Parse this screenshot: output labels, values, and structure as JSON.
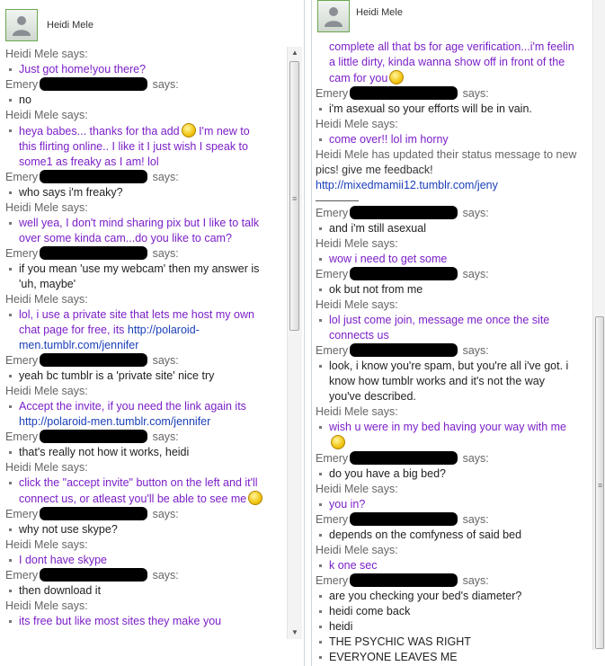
{
  "left": {
    "contact_name": "Heidi Mele",
    "messages": [
      {
        "speaker": "Heidi Mele",
        "says": "says:",
        "redacted": false,
        "lines": [
          {
            "text": "Just got home!you there?",
            "color": "purple"
          }
        ]
      },
      {
        "speaker": "Emery",
        "says": "says:",
        "redacted": true,
        "lines": [
          {
            "text": "no",
            "color": "black"
          }
        ]
      },
      {
        "speaker": "Heidi Mele",
        "says": "says:",
        "redacted": false,
        "lines": [
          {
            "text": "heya babes... thanks for tha add",
            "color": "purple",
            "smiley": true,
            "after": " I'm new to"
          },
          {
            "text": "this flirting online.. I like it I just wish I speak to",
            "color": "purple",
            "cont": true
          },
          {
            "text": "some1 as freaky as I am! lol",
            "color": "purple",
            "cont": true
          }
        ]
      },
      {
        "speaker": "Emery",
        "says": "says:",
        "redacted": true,
        "lines": [
          {
            "text": "who says i'm freaky?",
            "color": "black"
          }
        ]
      },
      {
        "speaker": "Heidi Mele",
        "says": "says:",
        "redacted": false,
        "lines": [
          {
            "text": "well yea, I  don't mind sharing pix but I like to talk",
            "color": "purple"
          },
          {
            "text": "over some kinda cam...do you like to cam?",
            "color": "purple",
            "cont": true
          }
        ]
      },
      {
        "speaker": "Emery",
        "says": "says:",
        "redacted": true,
        "lines": [
          {
            "text": "if you mean 'use my webcam' then my answer is",
            "color": "black"
          },
          {
            "text": "'uh, maybe'",
            "color": "black",
            "cont": true
          }
        ]
      },
      {
        "speaker": "Heidi Mele",
        "says": "says:",
        "redacted": false,
        "lines": [
          {
            "text": "lol, i use a private site that lets me host my own",
            "color": "purple"
          },
          {
            "text": "chat page for free, its ",
            "color": "purple",
            "cont": true,
            "link": "http://polaroid-"
          },
          {
            "text": "",
            "color": "purple",
            "cont": true,
            "link": "men.tumblr.com/jennifer"
          }
        ]
      },
      {
        "speaker": "Emery",
        "says": "says:",
        "redacted": true,
        "lines": [
          {
            "text": "yeah bc tumblr is a 'private site' nice try",
            "color": "black"
          }
        ]
      },
      {
        "speaker": "Heidi Mele",
        "says": "says:",
        "redacted": false,
        "lines": [
          {
            "text": "Accept the invite, if you need the link again its",
            "color": "purple"
          },
          {
            "text": "",
            "color": "purple",
            "cont": true,
            "link": "http://polaroid-men.tumblr.com/jennifer"
          }
        ]
      },
      {
        "speaker": "Emery",
        "says": "says:",
        "redacted": true,
        "lines": [
          {
            "text": "that's really not how it works, heidi",
            "color": "black"
          }
        ]
      },
      {
        "speaker": "Heidi Mele",
        "says": "says:",
        "redacted": false,
        "lines": [
          {
            "text": "click the \"accept invite\" button on the left and it'll",
            "color": "purple"
          },
          {
            "text": "connect us, or atleast you'll be able to see me",
            "color": "purple",
            "cont": true,
            "smiley": true
          }
        ]
      },
      {
        "speaker": "Emery",
        "says": "says:",
        "redacted": true,
        "lines": [
          {
            "text": "why not use skype?",
            "color": "black"
          }
        ]
      },
      {
        "speaker": "Heidi Mele",
        "says": "says:",
        "redacted": false,
        "lines": [
          {
            "text": "I dont have skype",
            "color": "purple"
          }
        ]
      },
      {
        "speaker": "Emery",
        "says": "says:",
        "redacted": true,
        "lines": [
          {
            "text": "then download it",
            "color": "black"
          }
        ]
      },
      {
        "speaker": "Heidi Mele",
        "says": "says:",
        "redacted": false,
        "lines": [
          {
            "text": "its free but like most sites they make you",
            "color": "purple"
          }
        ]
      }
    ]
  },
  "right": {
    "contact_name": "Heidi Mele",
    "messages": [
      {
        "speaker": "",
        "says": "",
        "redacted": false,
        "lines": [
          {
            "text": "complete all that bs for age verification...i'm feelin",
            "color": "purple",
            "cont": true
          },
          {
            "text": "a little dirty, kinda wanna show off in front of the",
            "color": "purple",
            "cont": true
          },
          {
            "text": "cam for you",
            "color": "purple",
            "cont": true,
            "smiley": true
          }
        ]
      },
      {
        "speaker": "Emery",
        "says": "says:",
        "redacted": true,
        "lines": [
          {
            "text": "i'm asexual so your efforts will be in vain.",
            "color": "black"
          }
        ]
      },
      {
        "speaker": "Heidi Mele",
        "says": "says:",
        "redacted": false,
        "lines": [
          {
            "text": "come over!! lol im horny",
            "color": "purple"
          }
        ]
      },
      {
        "speaker": "Heidi Mele has updated their status message to new",
        "says": "",
        "redacted": false,
        "plain": true,
        "lines": [
          {
            "text": "pics! give me feedback!",
            "color": "plain"
          },
          {
            "text": "",
            "color": "plain",
            "link": "http://mixedmamii12.tumblr.com/jeny"
          }
        ]
      },
      {
        "divider": true
      },
      {
        "speaker": "Emery",
        "says": "says:",
        "redacted": true,
        "lines": [
          {
            "text": "and i'm still asexual",
            "color": "black"
          }
        ]
      },
      {
        "speaker": "Heidi Mele",
        "says": "says:",
        "redacted": false,
        "lines": [
          {
            "text": "wow i need to get some",
            "color": "purple"
          }
        ]
      },
      {
        "speaker": "Emery",
        "says": "says:",
        "redacted": true,
        "lines": [
          {
            "text": "ok but not from me",
            "color": "black"
          }
        ]
      },
      {
        "speaker": "Heidi Mele",
        "says": "says:",
        "redacted": false,
        "lines": [
          {
            "text": "lol just come join, message me once the site",
            "color": "purple"
          },
          {
            "text": "connects us",
            "color": "purple",
            "cont": true
          }
        ]
      },
      {
        "speaker": "Emery",
        "says": "says:",
        "redacted": true,
        "lines": [
          {
            "text": "look, i know you're spam, but you're all i've got. i",
            "color": "black"
          },
          {
            "text": "know how tumblr works and it's not the way",
            "color": "black",
            "cont": true
          },
          {
            "text": "you've described.",
            "color": "black",
            "cont": true
          }
        ]
      },
      {
        "speaker": "Heidi Mele",
        "says": "says:",
        "redacted": false,
        "lines": [
          {
            "text": "wish u were in my bed having your way with me",
            "color": "purple"
          },
          {
            "text": "",
            "color": "purple",
            "cont": true,
            "smiley": true
          }
        ]
      },
      {
        "speaker": "Emery",
        "says": "says:",
        "redacted": true,
        "lines": [
          {
            "text": "do you have a big bed?",
            "color": "black"
          }
        ]
      },
      {
        "speaker": "Heidi Mele",
        "says": "says:",
        "redacted": false,
        "lines": [
          {
            "text": "you in?",
            "color": "purple"
          }
        ]
      },
      {
        "speaker": "Emery",
        "says": "says:",
        "redacted": true,
        "lines": [
          {
            "text": "depends on the comfyness of said bed",
            "color": "black"
          }
        ]
      },
      {
        "speaker": "Heidi Mele",
        "says": "says:",
        "redacted": false,
        "lines": [
          {
            "text": "k one sec",
            "color": "purple"
          }
        ]
      },
      {
        "speaker": "Emery",
        "says": "says:",
        "redacted": true,
        "lines": [
          {
            "text": "are you checking your bed's diameter?",
            "color": "black"
          },
          {
            "text": "heidi come back",
            "color": "black"
          },
          {
            "text": "heidi",
            "color": "black"
          },
          {
            "text": "THE PSYCHIC WAS RIGHT",
            "color": "black"
          },
          {
            "text": "EVERYONE LEAVES ME",
            "color": "black"
          }
        ]
      }
    ]
  },
  "colors": {
    "purple": "#7b1fc8",
    "link": "#1a3fb8",
    "speaker": "#666666"
  }
}
